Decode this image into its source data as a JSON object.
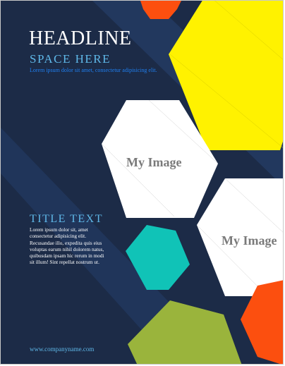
{
  "header": {
    "headline": "HEADLINE",
    "subhead": "SPACE HERE",
    "tagline": "Lorem ipsum dolor sit amet, consectetur adipisicing elit."
  },
  "images": [
    {
      "label": "My Image"
    },
    {
      "label": "My Image"
    }
  ],
  "section": {
    "title": "TITLE TEXT",
    "body_lines": [
      "Lorem ipsum dolor sit, amet",
      "consectetur adipisicing elit.",
      "Recusandae illo, expedita quis eius",
      "voluptas earum nihil dolorem natus,",
      "quibusdam ipsam hic rerum in modi",
      "sit illum! Sint repellat nostrum ut."
    ]
  },
  "footer": {
    "url": "www.companyname.com"
  },
  "colors": {
    "background": "#1c2b47",
    "stripe": "#22385e",
    "yellow": "#fff200",
    "orange": "#fc4f0f",
    "teal": "#10c3b7",
    "olive": "#9ab43c",
    "placeholder": "#ffffff",
    "accent_text": "#5fb8e8"
  }
}
